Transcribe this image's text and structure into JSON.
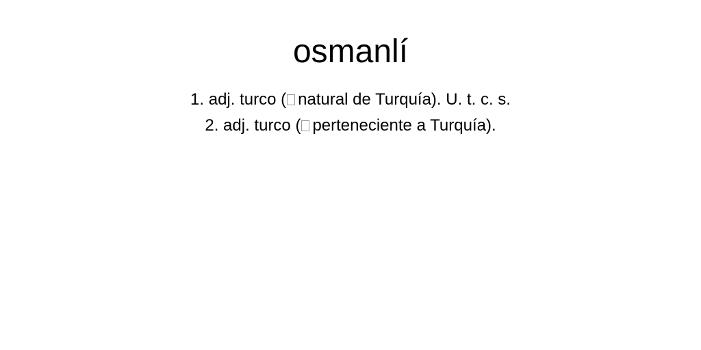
{
  "entry": {
    "headword": "osmanlí",
    "senses": [
      {
        "number": "1.",
        "category": "adj.",
        "lemma": "turco",
        "open_paren": "(",
        "gloss": "natural de Turquía).",
        "usage": "U. t. c. s."
      },
      {
        "number": "2.",
        "category": "adj.",
        "lemma": "turco",
        "open_paren": "(",
        "gloss": "perteneciente a Turquía).",
        "usage": ""
      }
    ]
  },
  "icons": {
    "missing_glyph": "arrow-icon"
  }
}
